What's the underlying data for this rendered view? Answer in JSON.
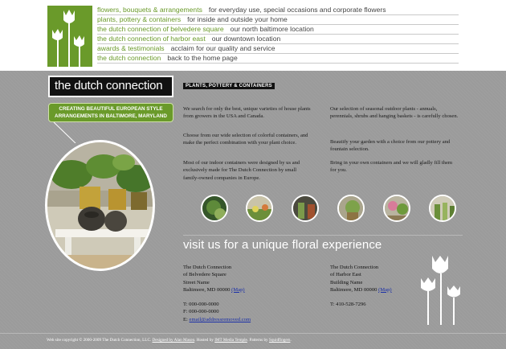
{
  "nav": [
    {
      "link": "flowers, bouquets & arrangements",
      "desc": "for everyday use, special occasions and corporate flowers"
    },
    {
      "link": "plants, pottery & containers",
      "desc": "for inside and outside your home"
    },
    {
      "link": "the dutch connection of belvedere square",
      "desc": "our north baltimore location"
    },
    {
      "link": "the dutch connection of harbor east",
      "desc": "our downtown location"
    },
    {
      "link": "awards & testimonials",
      "desc": "acclaim for our quality and service"
    },
    {
      "link": "the dutch connection",
      "desc": "back to the home page"
    }
  ],
  "brand": {
    "name": "the dutch connection",
    "banner_line1": "CREATING BEAUTIFUL EUROPEAN STYLE",
    "banner_line2": "ARRANGEMENTS IN BALTIMORE, MARYLAND"
  },
  "section_title": "PLANTS, POTTERY & CONTAINERS",
  "paragraphs_left": [
    "We search for only the best, unique varieties of house plants from growers in the USA and Canada.",
    "Choose from our wide selection of colorful containers, and make the perfect combination with your plant choice.",
    "Most of our indoor containers were designed by us and exclusively made for The Dutch Connection by small family-owned companies in Europe."
  ],
  "paragraphs_right": [
    "Our selection of seasonal outdoor plants - annuals, perennials, shrubs and hanging baskets - is carefully chosen.",
    "Beautify your garden with a choice from our pottery and fountain selection.",
    "Bring in your own containers and we will gladly fill them for you."
  ],
  "visit_heading": "visit us for a unique floral experience",
  "locations": [
    {
      "lines": [
        "The Dutch Connection",
        "of Belvedere Square",
        "Street Name"
      ],
      "city": "Baltimore, MD 00000",
      "map_label": "(Map)",
      "phone": "T: 000-000-0000",
      "fax": "F: 000-000-0000",
      "email_prefix": "E:",
      "email": "email@addressremoved.com"
    },
    {
      "lines": [
        "The Dutch Connection",
        "of Harbor East",
        "Building Name"
      ],
      "city": "Baltimore, MD 00000",
      "map_label": "(Map)",
      "phone": "T: 410-528-7296"
    }
  ],
  "footer": {
    "copyright": "Web site copyright © 2000-2009 The Dutch Connection, LLC.",
    "designed_link": "Designed by Alan Mason",
    "hosted_text": ". Hosted by",
    "hosted_link": "IMT Media Temple",
    "patterns_text": ". Patterns by",
    "patterns_link": "Squidfingers",
    "end": "."
  },
  "colors": {
    "brand_green": "#6a9a2a",
    "background_grey": "#9b9b9b",
    "link_blue": "#1a2fa8"
  }
}
